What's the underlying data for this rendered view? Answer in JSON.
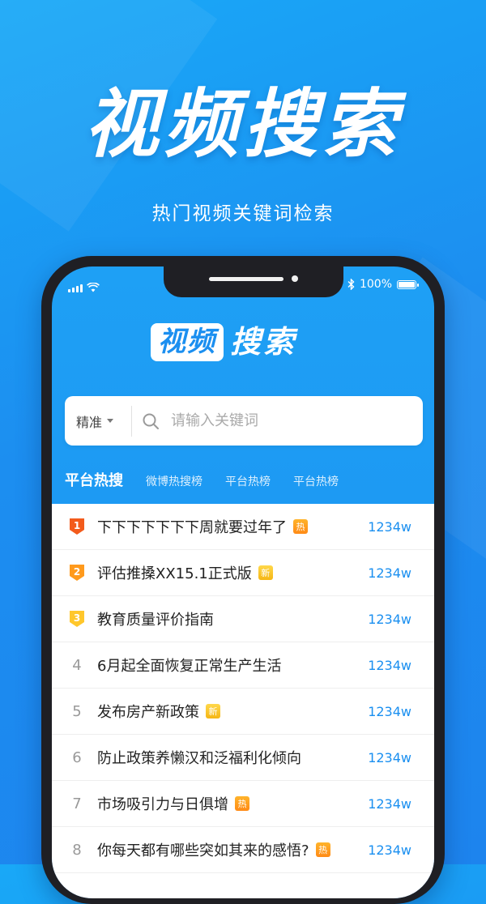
{
  "promo": {
    "title": "视频搜索",
    "subtitle": "热门视频关键词检索"
  },
  "status_bar": {
    "battery": "100%",
    "battery_level": 100
  },
  "app": {
    "logo_box": "视频",
    "logo_text": "搜索"
  },
  "search": {
    "mode": "精准",
    "placeholder": "请输入关键词"
  },
  "tabs": [
    {
      "label": "平台热搜",
      "active": true
    },
    {
      "label": "微博热搜榜",
      "active": false
    },
    {
      "label": "平台热榜",
      "active": false
    },
    {
      "label": "平台热榜",
      "active": false
    }
  ],
  "colors": {
    "accent": "#1a8ff0",
    "rank1": "#f35b1c",
    "rank2": "#ff9a1c",
    "rank3": "#ffc72c"
  },
  "list": [
    {
      "rank": "1",
      "title": "下下下下下下下周就要过年了",
      "badge": "热",
      "badge_type": "hot",
      "count": "1234w"
    },
    {
      "rank": "2",
      "title": "评估推搡XX15.1正式版",
      "badge": "新",
      "badge_type": "new",
      "count": "1234w"
    },
    {
      "rank": "3",
      "title": "教育质量评价指南",
      "badge": "",
      "badge_type": "",
      "count": "1234w"
    },
    {
      "rank": "4",
      "title": "6月起全面恢复正常生产生活",
      "badge": "",
      "badge_type": "",
      "count": "1234w"
    },
    {
      "rank": "5",
      "title": "发布房产新政策",
      "badge": "新",
      "badge_type": "new",
      "count": "1234w"
    },
    {
      "rank": "6",
      "title": "防止政策养懒汉和泛福利化倾向",
      "badge": "",
      "badge_type": "",
      "count": "1234w"
    },
    {
      "rank": "7",
      "title": "市场吸引力与日俱增",
      "badge": "热",
      "badge_type": "hot",
      "count": "1234w"
    },
    {
      "rank": "8",
      "title": "你每天都有哪些突如其来的感悟?",
      "badge": "热",
      "badge_type": "hot",
      "count": "1234w"
    }
  ]
}
